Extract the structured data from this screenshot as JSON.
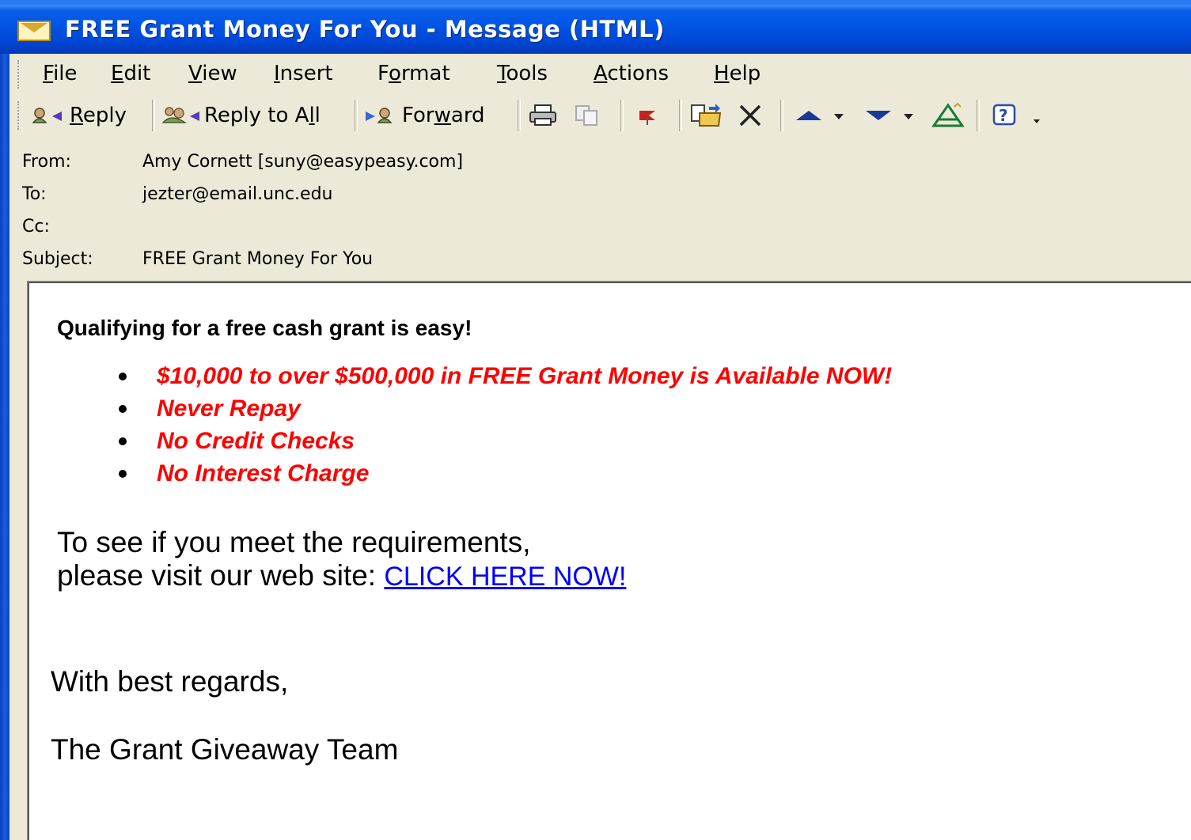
{
  "window": {
    "title": "FREE Grant Money For You - Message (HTML)"
  },
  "menu": {
    "items": [
      {
        "pre": "",
        "u": "F",
        "post": "ile"
      },
      {
        "pre": "",
        "u": "E",
        "post": "dit"
      },
      {
        "pre": "",
        "u": "V",
        "post": "iew"
      },
      {
        "pre": "",
        "u": "I",
        "post": "nsert"
      },
      {
        "pre": "F",
        "u": "o",
        "post": "rmat"
      },
      {
        "pre": "",
        "u": "T",
        "post": "ools"
      },
      {
        "pre": "",
        "u": "A",
        "post": "ctions"
      },
      {
        "pre": "",
        "u": "H",
        "post": "elp"
      }
    ]
  },
  "toolbar": {
    "reply": {
      "pre": "",
      "u": "R",
      "post": "eply"
    },
    "reply_all": {
      "pre": "Reply to A",
      "u": "l",
      "post": "l"
    },
    "forward": {
      "pre": "For",
      "u": "w",
      "post": "ard"
    },
    "icons": [
      "reply-icon",
      "reply-all-icon",
      "forward-icon",
      "print-icon",
      "copy-icon",
      "flag-icon",
      "move-to-folder-icon",
      "delete-icon",
      "previous-item-icon",
      "next-item-icon",
      "address-book-icon",
      "help-icon"
    ]
  },
  "header": {
    "from_label": "From:",
    "from_value": "Amy Cornett [suny@easypeasy.com]",
    "to_label": "To:",
    "to_value": "jezter@email.unc.edu",
    "cc_label": "Cc:",
    "cc_value": "",
    "subject_label": "Subject:",
    "subject_value": "FREE Grant Money For You"
  },
  "message": {
    "headline": "Qualifying for a free cash grant is easy!",
    "bullets": [
      "$10,000 to over $500,000 in FREE Grant Money is Available NOW!",
      "Never Repay",
      "No Credit Checks",
      "No Interest Charge"
    ],
    "line1": "To see if you meet the requirements,",
    "line2": "please visit our web site: ",
    "link": "CLICK HERE NOW!",
    "regards": "With best regards,",
    "signature": "The Grant Giveaway Team"
  },
  "colors": {
    "titlebar": "#0055e5",
    "chrome": "#ece9d8",
    "bullet_text": "#ff0000",
    "link": "#0000ff"
  }
}
